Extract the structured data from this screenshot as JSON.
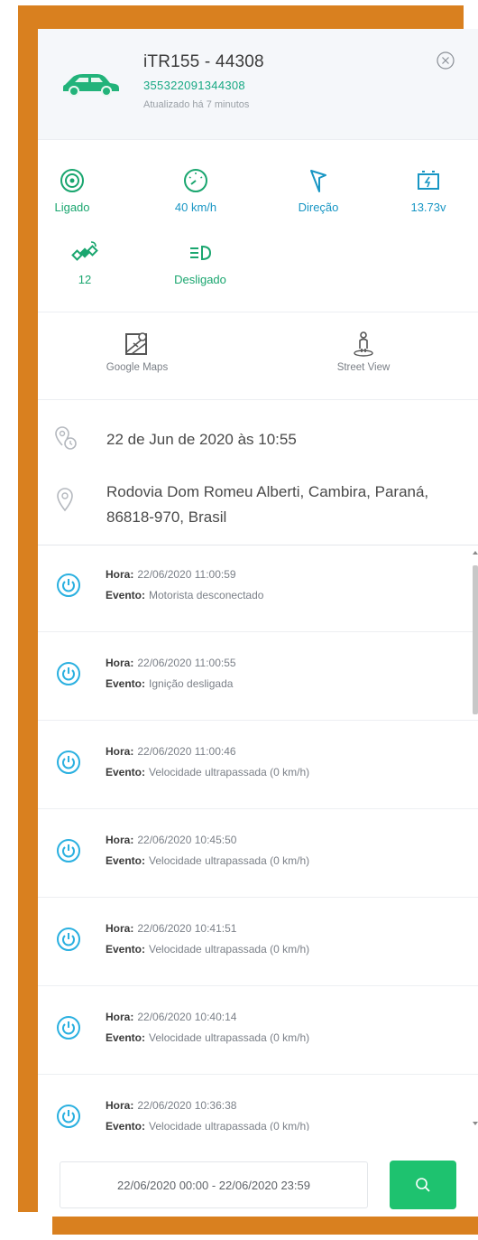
{
  "device": {
    "name": "iTR155 - 44308",
    "imei": "355322091344308",
    "updated": "Atualizado há 7 minutos"
  },
  "stats": [
    {
      "label": "Ligado",
      "icon": "ignition-on-icon",
      "color": "#1aa66f"
    },
    {
      "label": "40 km/h",
      "icon": "speedometer-icon",
      "color": "#1896c4"
    },
    {
      "label": "Direção",
      "icon": "direction-arrow-icon",
      "color": "#1896c4"
    },
    {
      "label": "13.73v",
      "icon": "battery-voltage-icon",
      "color": "#1896c4"
    },
    {
      "label": "12",
      "icon": "satellite-icon",
      "color": "#1aa66f"
    },
    {
      "label": "Desligado",
      "icon": "headlight-icon",
      "color": "#1aa66f"
    }
  ],
  "maps": {
    "google": "Google Maps",
    "street": "Street View"
  },
  "info": {
    "date": "22 de Jun de 2020 às 10:55",
    "address": "Rodovia Dom Romeu Alberti, Cambira, Paraná, 86818-970, Brasil"
  },
  "event_labels": {
    "hora": "Hora:",
    "evento": "Evento:"
  },
  "events": [
    {
      "hora": "22/06/2020 11:00:59",
      "evento": "Motorista desconectado"
    },
    {
      "hora": "22/06/2020 11:00:55",
      "evento": "Ignição desligada"
    },
    {
      "hora": "22/06/2020 11:00:46",
      "evento": "Velocidade ultrapassada (0 km/h)"
    },
    {
      "hora": "22/06/2020 10:45:50",
      "evento": "Velocidade ultrapassada (0 km/h)"
    },
    {
      "hora": "22/06/2020 10:41:51",
      "evento": "Velocidade ultrapassada (0 km/h)"
    },
    {
      "hora": "22/06/2020 10:40:14",
      "evento": "Velocidade ultrapassada (0 km/h)"
    },
    {
      "hora": "22/06/2020 10:36:38",
      "evento": "Velocidade ultrapassada (0 km/h)"
    }
  ],
  "filter": {
    "date_range": "22/06/2020 00:00 - 22/06/2020 23:59"
  },
  "colors": {
    "accent_orange": "#d9801f",
    "green": "#1aa66f",
    "cyan": "#1896c4",
    "search_button": "#1ec26f"
  }
}
